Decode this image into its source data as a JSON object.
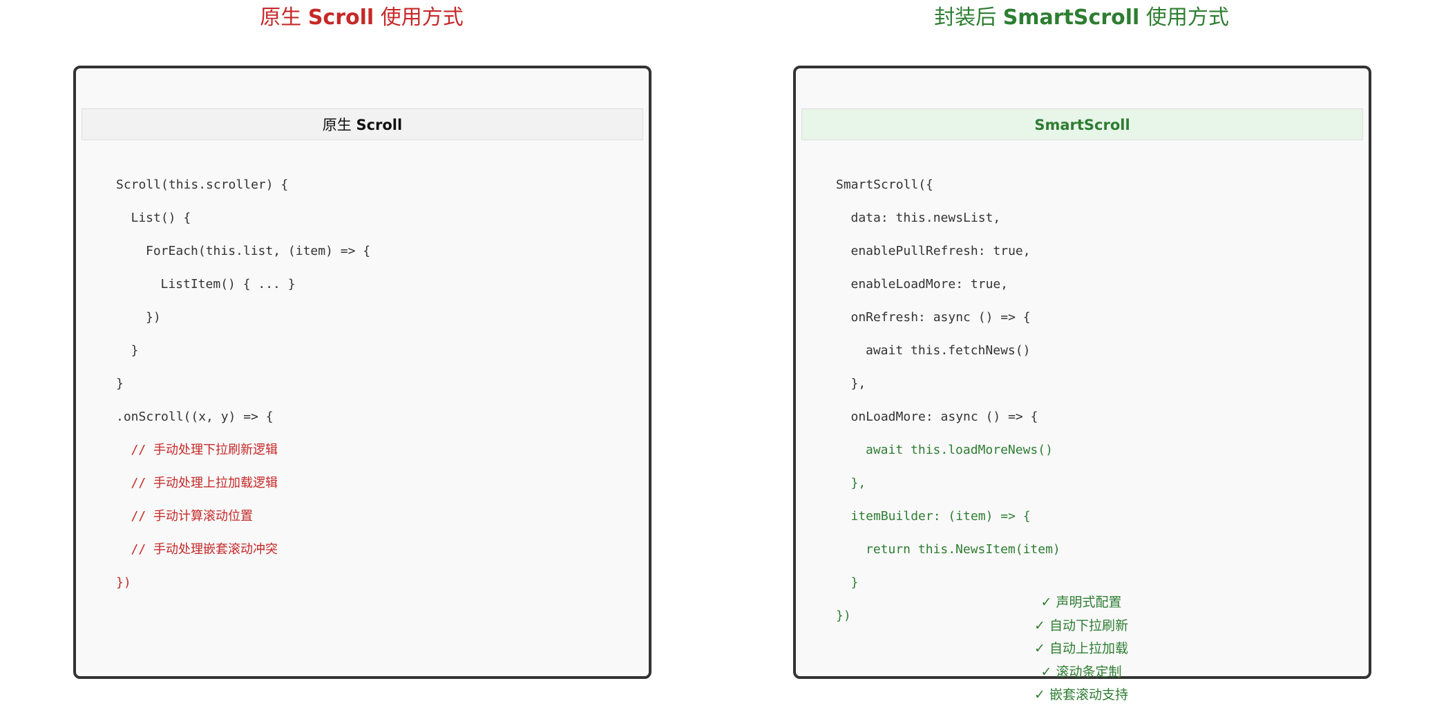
{
  "left": {
    "title_prefix": "原生 ",
    "title_bold": "Scroll",
    "title_suffix": " 使用方式",
    "header_prefix": "原生 ",
    "header_bold": "Scroll",
    "code": [
      {
        "text": "Scroll(this.scroller) {",
        "indent": 0,
        "color": "dark"
      },
      {
        "text": "List() {",
        "indent": 1,
        "color": "dark"
      },
      {
        "text": "ForEach(this.list, (item) => {",
        "indent": 2,
        "color": "dark"
      },
      {
        "text": "ListItem() { ... }",
        "indent": 3,
        "color": "dark"
      },
      {
        "text": "})",
        "indent": 2,
        "color": "dark"
      },
      {
        "text": "}",
        "indent": 1,
        "color": "dark"
      },
      {
        "text": "}",
        "indent": 0,
        "color": "dark"
      },
      {
        "text": ".onScroll((x, y) => {",
        "indent": 0,
        "color": "dark"
      },
      {
        "text": "// 手动处理下拉刷新逻辑",
        "indent": 1,
        "color": "red"
      },
      {
        "text": "// 手动处理上拉加载逻辑",
        "indent": 1,
        "color": "red"
      },
      {
        "text": "// 手动计算滚动位置",
        "indent": 1,
        "color": "red"
      },
      {
        "text": "// 手动处理嵌套滚动冲突",
        "indent": 1,
        "color": "red"
      },
      {
        "text": "})",
        "indent": 0,
        "color": "red"
      }
    ]
  },
  "right": {
    "title_prefix": "封装后 ",
    "title_bold": "SmartScroll",
    "title_suffix": " 使用方式",
    "header": "SmartScroll",
    "code": [
      {
        "text": "SmartScroll({",
        "indent": 0,
        "color": "dark"
      },
      {
        "text": "data: this.newsList,",
        "indent": 1,
        "color": "dark"
      },
      {
        "text": "enablePullRefresh: true,",
        "indent": 1,
        "color": "dark"
      },
      {
        "text": "enableLoadMore: true,",
        "indent": 1,
        "color": "dark"
      },
      {
        "text": "onRefresh: async () => {",
        "indent": 1,
        "color": "dark"
      },
      {
        "text": "await this.fetchNews()",
        "indent": 2,
        "color": "dark"
      },
      {
        "text": "},",
        "indent": 1,
        "color": "dark"
      },
      {
        "text": "onLoadMore: async () => {",
        "indent": 1,
        "color": "dark"
      },
      {
        "text": "await this.loadMoreNews()",
        "indent": 2,
        "color": "green"
      },
      {
        "text": "},",
        "indent": 1,
        "color": "green"
      },
      {
        "text": "itemBuilder: (item) => {",
        "indent": 1,
        "color": "green"
      },
      {
        "text": "return this.NewsItem(item)",
        "indent": 2,
        "color": "green"
      },
      {
        "text": "}",
        "indent": 1,
        "color": "green"
      },
      {
        "text": "})",
        "indent": 0,
        "color": "green"
      }
    ],
    "features": [
      "✓ 声明式配置",
      "✓ 自动下拉刷新",
      "✓ 自动上拉加载",
      "✓ 滚动条定制",
      "✓ 嵌套滚动支持"
    ]
  },
  "colors": {
    "red": "#c62828",
    "green": "#2e7d32",
    "dark": "#333333",
    "panel_border": "#333333",
    "panel_bg": "#f9f9f9",
    "header_left_bg": "#f2f2f2",
    "header_right_bg": "#e8f5e9"
  }
}
